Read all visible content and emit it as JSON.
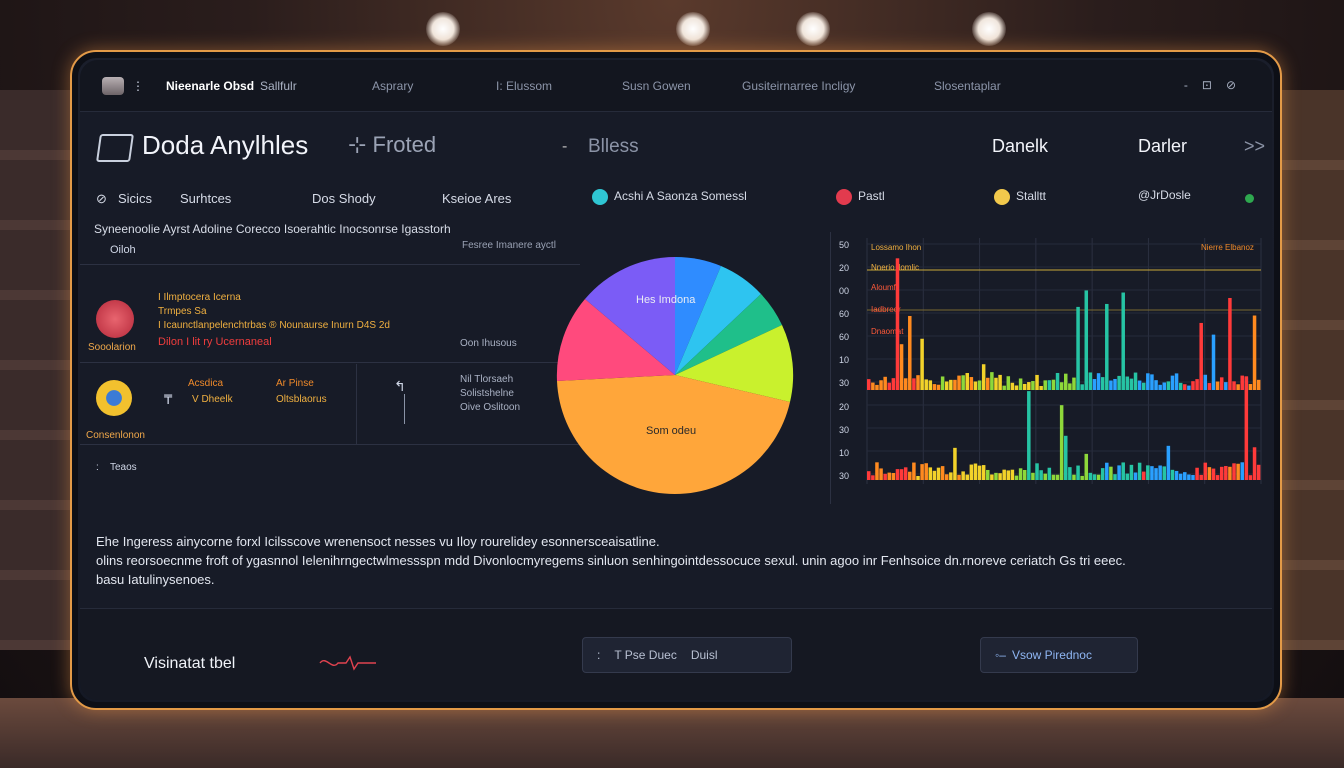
{
  "window": {
    "brand": "Nieenarle Obsd",
    "brand_sub": "Sallfulr",
    "tabs": [
      "Asprary",
      "I: Elussom",
      "Susn Gowen",
      "Gusiteirnarree Incligy",
      "Slosentaplar"
    ],
    "controls": [
      "-",
      "⊡",
      "⊘"
    ]
  },
  "header": {
    "title": "Doda Anylhles",
    "subtitle": "⊹ Froted",
    "middle_label": "Blless",
    "right_label_1": "Danelk",
    "right_label_2": "Darler",
    "chevron": ">>"
  },
  "filters": {
    "items": [
      "Sicics",
      "Surhtces",
      "Dos Shody",
      "Kseioe Ares"
    ],
    "badge_1": "Acshi A Saonza Somessl",
    "badge_2": "Pastl",
    "badge_3": "Stalltt",
    "badge_4": "@JrDosle"
  },
  "left_panel": {
    "heading": "Syneenoolie Ayrst Adoline Corecco Isoerahtic Inocsonrse Igasstorh",
    "subheading": "Oiloh",
    "right_note": "Fesree Imanere ayctl",
    "card1": {
      "title": "I Ilmptocera Icerna",
      "line2": "Trmpes Sa",
      "line3": "I Icaunctlanpelenchtrbas ® Nounaurse Inurn D4S 2d",
      "footer": "Dilon I lit ry Ucernaneal",
      "note": "Oon Ihusous",
      "caption": "Sooolarion"
    },
    "card2": {
      "col1_line1": "Acsdica",
      "col1_line2": "V Dheelk",
      "col2_line1": "Ar Pinse",
      "col2_line2": "Oltsblaorus",
      "mid_info_1": "Nil Tlorsaeh",
      "mid_info_2": "Solistshelne",
      "mid_info_3": "Oive Oslitoon",
      "caption": "Consenlonon",
      "sym": "₸"
    },
    "footer_item": "Teaos",
    "footer_prefix": ":"
  },
  "pie": {
    "label_top": "Hes Imdona",
    "label_bottom": "Som odeu"
  },
  "chart_data": {
    "type": "bar",
    "title": "",
    "y_ticks_top": [
      "50",
      "20",
      "00",
      "60",
      "60",
      "10",
      "30"
    ],
    "y_ticks_bottom": [
      "20",
      "30",
      "10",
      "30"
    ],
    "legend_top": [
      "Lossamo Ihon",
      "Nnerio llomlic"
    ],
    "legend_top_right": "Nierre Elbanoz",
    "legend_mid": [
      "Aloumf",
      "Iadbreor",
      "Dnaomat"
    ],
    "colors": [
      "#ff3a3a",
      "#ff8a1f",
      "#f2d22a",
      "#8ed83a",
      "#26c4a4",
      "#2aa0ff"
    ]
  },
  "bottom_text": {
    "line1": "Ehe Ingeress ainycorne forxl Icilsscove wrenensoct nesses vu Iloy rourelidey esonnersceaisatline.",
    "line2": "olins reorsoecnme froft of ygasnnol Ielenihrngectwlmessspn mdd Divonlocmyregems sinluon senhingointdessocuce sexul. unin agoo inr Fenhsoice dn.rnoreve ceriatch Gs tri eeec.",
    "line3": "basu Iatulinysenoes."
  },
  "bottom_panel": {
    "vis_label": "Visinatat tbel",
    "button1_label": "T Pse Duec",
    "button1_suffix": "Duisl",
    "button1_prefix": ":",
    "button2_label": "Vsow Pirednoc",
    "button2_prefix": "◦–"
  }
}
